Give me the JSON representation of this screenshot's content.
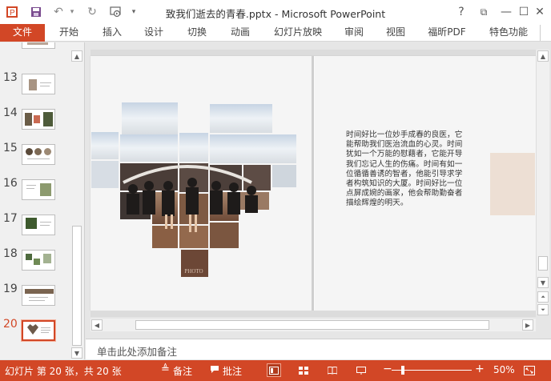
{
  "window": {
    "title": "致我们逝去的青春.pptx - Microsoft PowerPoint",
    "help": "?",
    "restore": "⧉",
    "minimize": "—",
    "maximize": "☐",
    "close": "✕"
  },
  "quick_access": {
    "save_glyph": "💾",
    "undo_glyph": "↶",
    "undo_arrow": "▾",
    "redo_glyph": "↻",
    "present_glyph": "⊡",
    "customize_glyph": "▾"
  },
  "ribbon": {
    "tabs": [
      "文件",
      "开始",
      "插入",
      "设计",
      "切换",
      "动画",
      "幻灯片放映",
      "审阅",
      "视图",
      "福昕PDF",
      "特色功能"
    ]
  },
  "thumbnails": {
    "items": [
      {
        "number": "13"
      },
      {
        "number": "14"
      },
      {
        "number": "15"
      },
      {
        "number": "16"
      },
      {
        "number": "17"
      },
      {
        "number": "18"
      },
      {
        "number": "19"
      },
      {
        "number": "20"
      }
    ],
    "active_index": 7
  },
  "slide": {
    "body_text": "时间好比一位妙手成春的良医，它能帮助我们医治流血的心灵。时间犹如一个万能的慰藉者，它能开导我们忘记人生的伤痛。时间有如一位循循善诱的智者，他能引导求学者构筑知识的大厦。时间好比一位点屏成婉的画家，他会帮助勤奋者描绘辉煌的明天。",
    "photo_caption": "PHOTO"
  },
  "notes": {
    "placeholder": "单击此处添加备注"
  },
  "status": {
    "slide_info": "幻灯片 第 20 张，共 20 张",
    "notes_label": "备注",
    "comments_label": "批注",
    "zoom_minus": "−",
    "zoom_plus": "+",
    "zoom_level": "50%",
    "zoom_value": 50,
    "fit_icon": "fit-to-window-icon"
  },
  "colors": {
    "accent": "#d24726",
    "pink_box": "#eddfd4"
  }
}
